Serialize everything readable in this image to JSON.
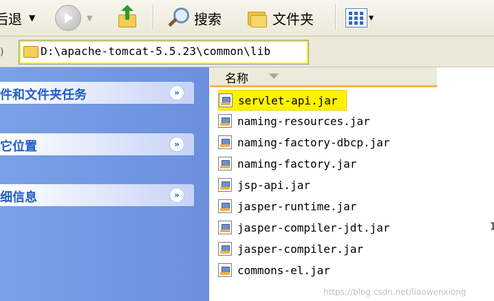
{
  "toolbar": {
    "back_label": "后退",
    "back_arrow": "▼",
    "forward_arrow": "▼",
    "search_label": "搜索",
    "folders_label": "文件夹",
    "views_arrow": "▾"
  },
  "address": {
    "tick": ")",
    "path": "D:\\apache-tomcat-5.5.23\\common\\lib"
  },
  "taskpane": {
    "sections": [
      {
        "title": "件和文件夹任务",
        "chevron": "»"
      },
      {
        "title": "它位置",
        "chevron": "»"
      },
      {
        "title": "细信息",
        "chevron": "»"
      }
    ]
  },
  "list": {
    "column_name": "名称",
    "files": [
      {
        "name": "servlet-api.jar",
        "selected": true
      },
      {
        "name": "naming-resources.jar"
      },
      {
        "name": "naming-factory-dbcp.jar"
      },
      {
        "name": "naming-factory.jar"
      },
      {
        "name": "jsp-api.jar"
      },
      {
        "name": "jasper-runtime.jar"
      },
      {
        "name": "jasper-compiler-jdt.jar"
      },
      {
        "name": "jasper-compiler.jar"
      },
      {
        "name": "commons-el.jar"
      }
    ]
  },
  "stray_char": "1",
  "watermark": "https://blog.csdn.net/liaowenxiong",
  "colors": {
    "highlight": "#fff200",
    "taskpane_blue": "#6b8fde",
    "task_title": "#215dc6"
  }
}
